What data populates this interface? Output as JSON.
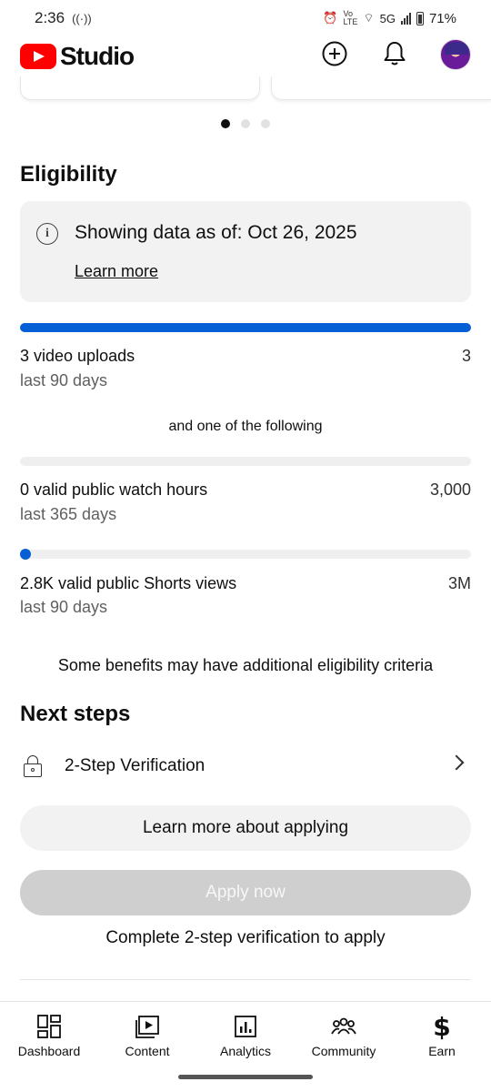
{
  "status_bar": {
    "time": "2:36",
    "network": "5G",
    "battery": "71%"
  },
  "header": {
    "logo_text": "Studio",
    "brand_color": "#ff0000",
    "icons": [
      "create-icon",
      "notifications-icon",
      "avatar"
    ]
  },
  "carousel": {
    "page_count": 3,
    "active_index": 0
  },
  "eligibility": {
    "title": "Eligibility",
    "info_text": "Showing data as of: Oct 26, 2025",
    "learn_more": "Learn more",
    "accent_color": "#065fd4",
    "requirements": [
      {
        "title": "3 video uploads",
        "period": "last 90 days",
        "target": "3",
        "progress": 1.0
      },
      {
        "title": "0 valid public watch hours",
        "period": "last 365 days",
        "target": "3,000",
        "progress": 0.0
      },
      {
        "title": "2.8K valid public Shorts views",
        "period": "last 90 days",
        "target": "3M",
        "progress": 0.001
      }
    ],
    "separator_text": "and one of the following",
    "note": "Some benefits may have additional eligibility criteria"
  },
  "next_steps": {
    "title": "Next steps",
    "step_label": "2-Step Verification",
    "learn_more_button": "Learn more about applying",
    "apply_button": "Apply now",
    "apply_note": "Complete 2-step verification to apply"
  },
  "bottom_nav": {
    "items": [
      {
        "label": "Dashboard",
        "icon": "dashboard-icon"
      },
      {
        "label": "Content",
        "icon": "content-icon"
      },
      {
        "label": "Analytics",
        "icon": "analytics-icon"
      },
      {
        "label": "Community",
        "icon": "community-icon"
      },
      {
        "label": "Earn",
        "icon": "earn-icon"
      }
    ]
  }
}
